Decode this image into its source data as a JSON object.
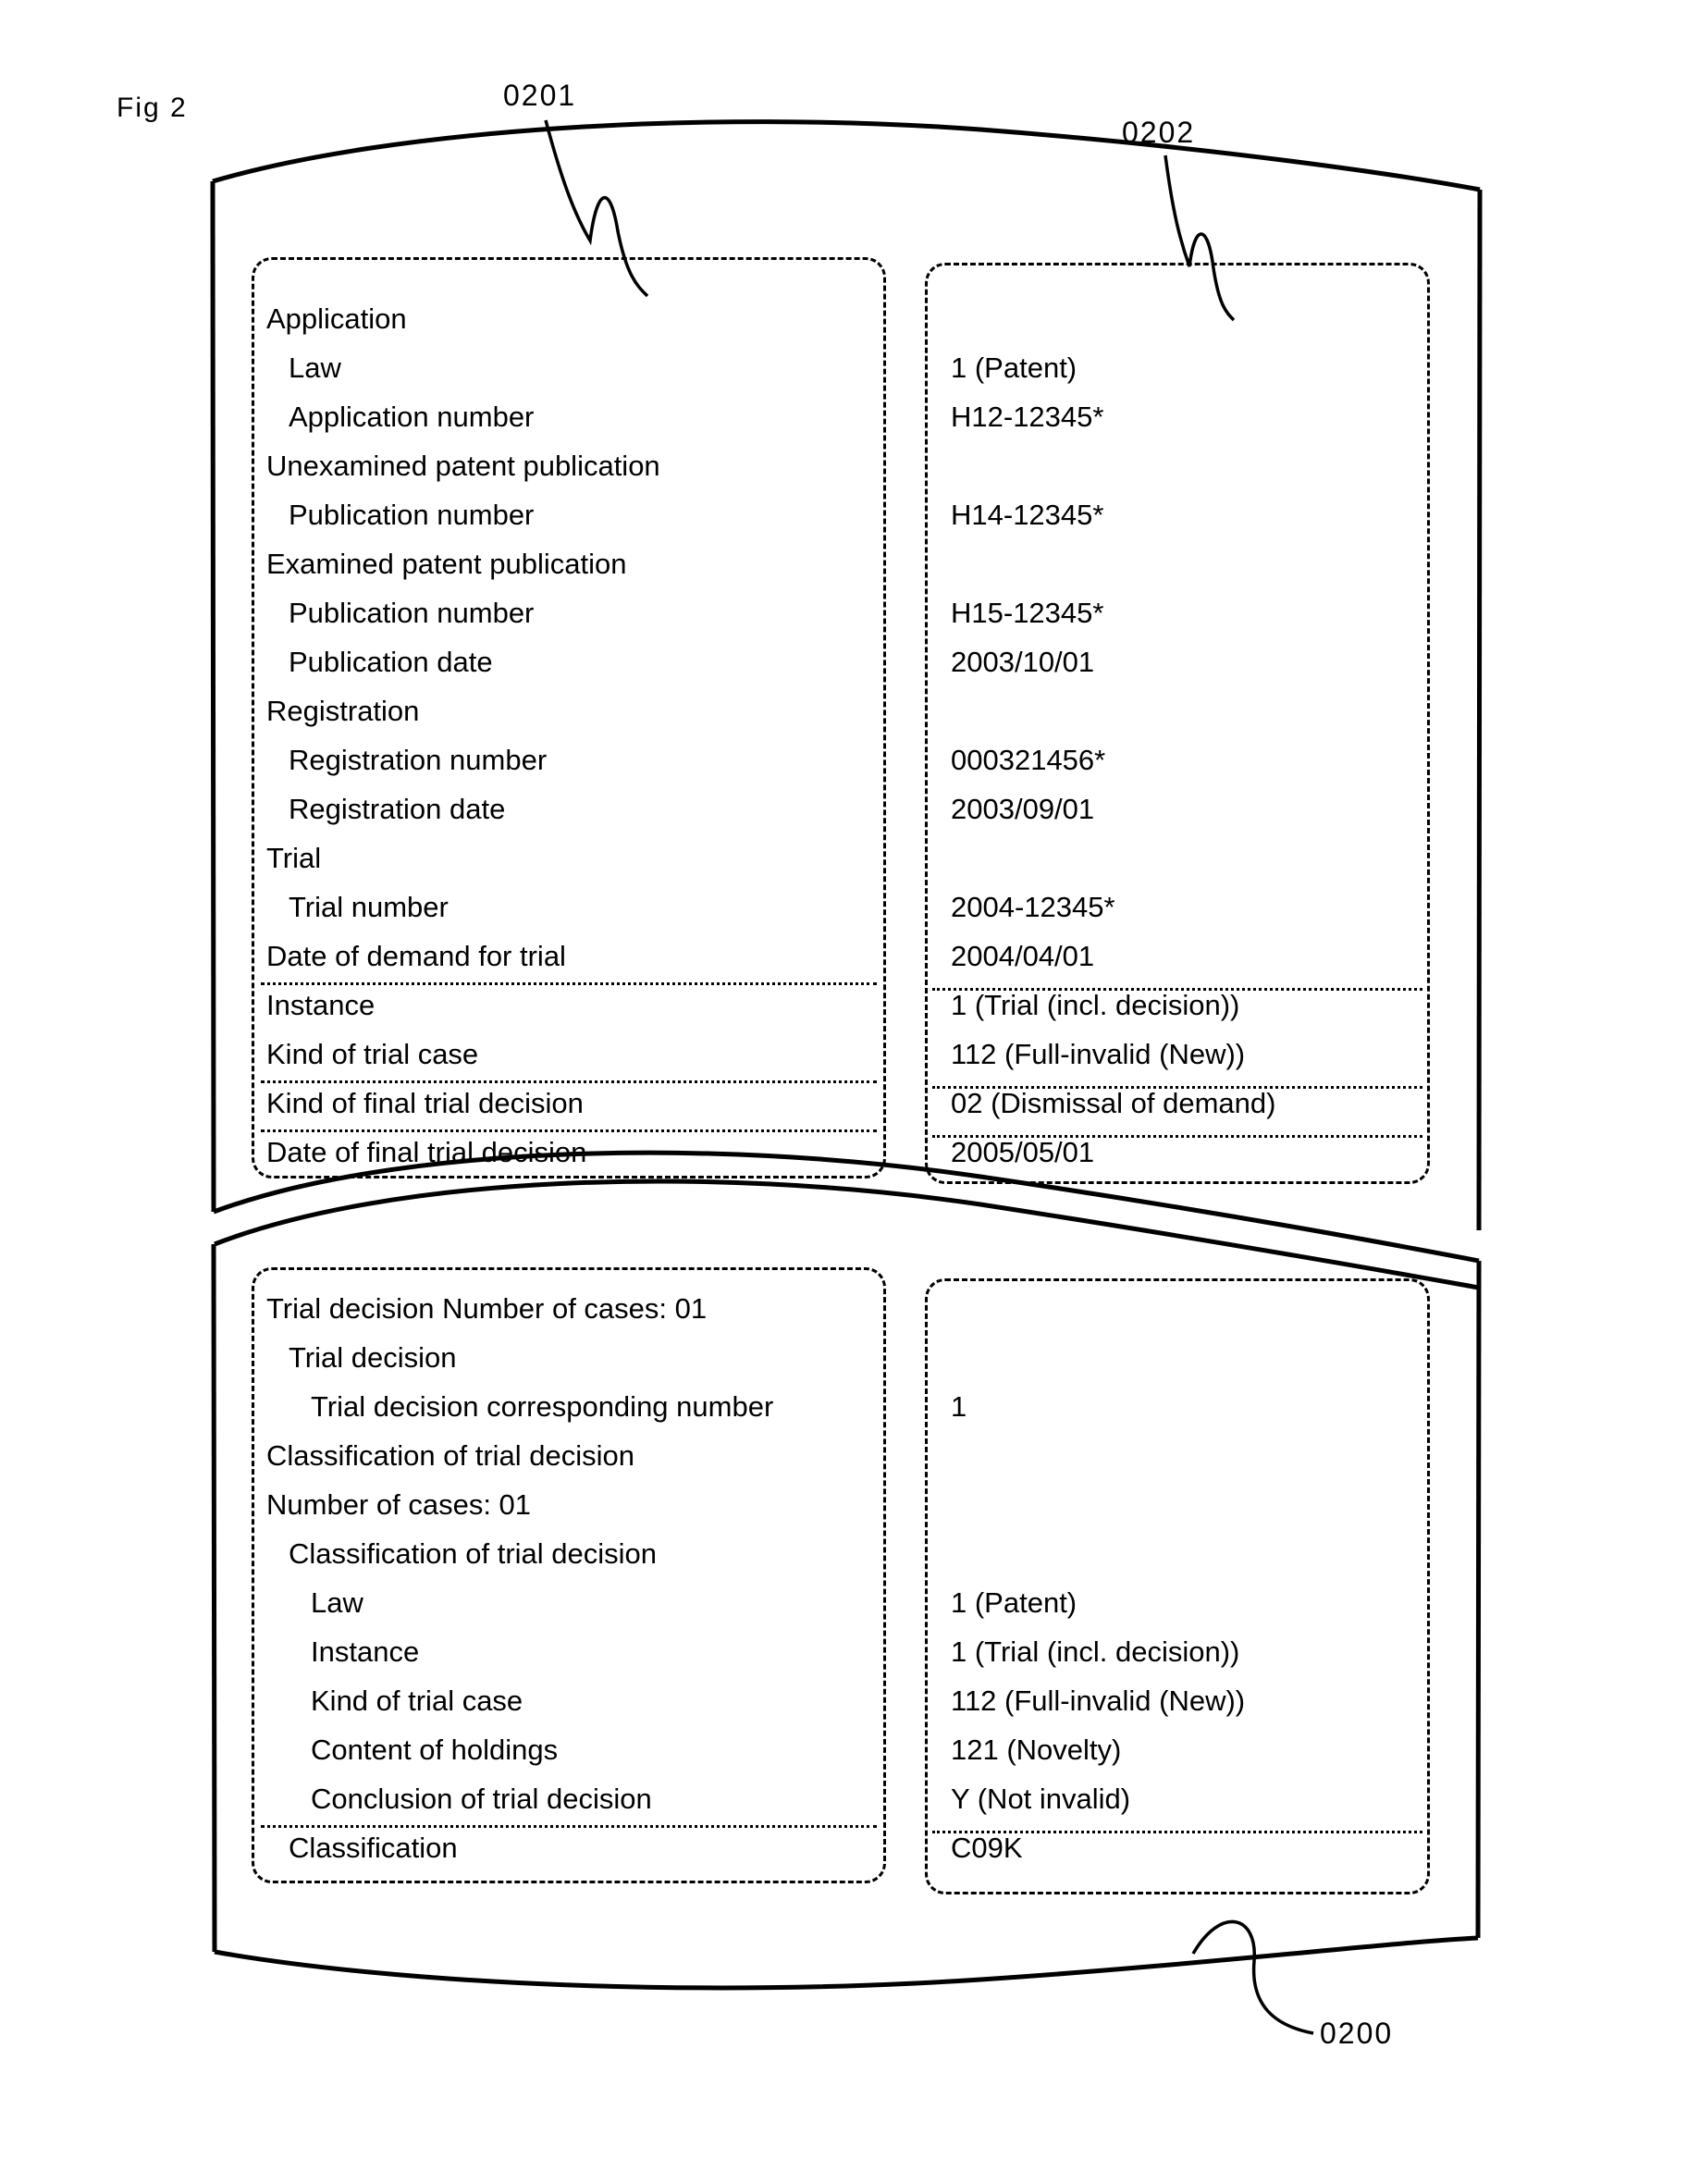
{
  "figure": {
    "label": "Fig 2",
    "ref_page": "0200",
    "ref_left_box": "0201",
    "ref_right_box": "0202"
  },
  "upper_panel": {
    "rows": [
      {
        "label": "Application",
        "value": "",
        "indent": 0
      },
      {
        "label": "Law",
        "value": "1 (Patent)",
        "indent": 1
      },
      {
        "label": "Application number",
        "value": "H12-12345*",
        "indent": 1
      },
      {
        "label": "Unexamined patent publication",
        "value": "",
        "indent": 0
      },
      {
        "label": "Publication number",
        "value": "H14-12345*",
        "indent": 1
      },
      {
        "label": "Examined patent publication",
        "value": "",
        "indent": 0
      },
      {
        "label": "Publication number",
        "value": "H15-12345*",
        "indent": 1
      },
      {
        "label": "Publication date",
        "value": "2003/10/01",
        "indent": 1
      },
      {
        "label": "Registration",
        "value": "",
        "indent": 0
      },
      {
        "label": "Registration number",
        "value": "000321456*",
        "indent": 1
      },
      {
        "label": "Registration date",
        "value": "2003/09/01",
        "indent": 1
      },
      {
        "label": "Trial",
        "value": "",
        "indent": 0
      },
      {
        "label": "Trial number",
        "value": "2004-12345*",
        "indent": 1
      },
      {
        "label": "Date of demand for trial",
        "value": "2004/04/01",
        "indent": 0
      },
      {
        "label": "Instance",
        "value": "1 (Trial (incl. decision))",
        "indent": 0
      },
      {
        "label": "Kind of trial case",
        "value": "112 (Full-invalid (New))",
        "indent": 0
      },
      {
        "label": "Kind of final trial decision",
        "value": "02 (Dismissal of demand)",
        "indent": 0
      },
      {
        "label": "Date of final trial decision",
        "value": "2005/05/01",
        "indent": 0
      }
    ],
    "separators_after_row": [
      13,
      15,
      16
    ]
  },
  "lower_panel": {
    "rows": [
      {
        "label": "Trial decision Number of cases: 01",
        "value": "",
        "indent": 0
      },
      {
        "label": "Trial decision",
        "value": "",
        "indent": 1
      },
      {
        "label": "Trial decision corresponding number",
        "value": "1",
        "indent": 2
      },
      {
        "label": "Classification of trial decision",
        "value": "",
        "indent": 0
      },
      {
        "label": "Number of cases: 01",
        "value": "",
        "indent": 0
      },
      {
        "label": "Classification of trial decision",
        "value": "",
        "indent": 1
      },
      {
        "label": "Law",
        "value": "1 (Patent)",
        "indent": 2
      },
      {
        "label": "Instance",
        "value": "1 (Trial (incl. decision))",
        "indent": 2
      },
      {
        "label": "Kind of trial case",
        "value": "112 (Full-invalid (New))",
        "indent": 2
      },
      {
        "label": "Content of holdings",
        "value": "121 (Novelty)",
        "indent": 2
      },
      {
        "label": "Conclusion of trial decision",
        "value": "Y (Not invalid)",
        "indent": 2
      },
      {
        "label": "Classification",
        "value": "C09K",
        "indent": 3
      }
    ],
    "separators_after_row": [
      10
    ]
  }
}
